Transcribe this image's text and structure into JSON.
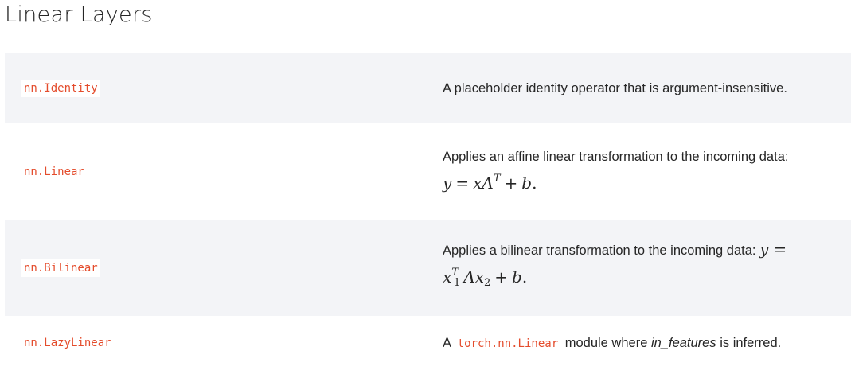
{
  "page": {
    "title": "Linear Layers"
  },
  "colors": {
    "code_link": "#e44c2c",
    "shaded_row": "#f3f4f7",
    "text": "#262626"
  },
  "rows": [
    {
      "name": "nn.Identity",
      "description": "A placeholder identity operator that is argument-insensitive."
    },
    {
      "name": "nn.Linear",
      "description": "Applies an affine linear transformation to the incoming data:",
      "formula": {
        "y": "y",
        "eq": "=",
        "x": "x",
        "A": "A",
        "T": "T",
        "plus": "+",
        "b": "b",
        "end": "."
      }
    },
    {
      "name": "nn.Bilinear",
      "description": "Applies a bilinear transformation to the incoming data:",
      "formula": {
        "y": "y",
        "eq": "=",
        "x1": "x",
        "sub1": "1",
        "T": "T",
        "A": "A",
        "x2": "x",
        "sub2": "2",
        "plus": "+",
        "b": "b",
        "end": "."
      }
    },
    {
      "name": "nn.LazyLinear",
      "description_prefix": "A",
      "description_code": "torch.nn.Linear",
      "description_middle": "module where",
      "description_emphasis": "in_features",
      "description_suffix": "is inferred."
    }
  ]
}
